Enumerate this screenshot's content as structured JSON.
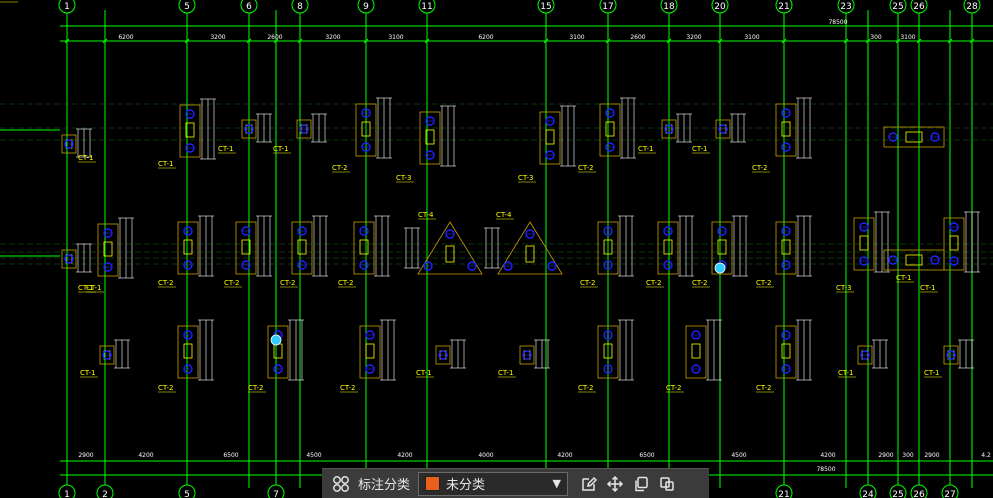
{
  "colors": {
    "background": "#000000",
    "grid": "#00ff00",
    "dimension": "#ffffff",
    "outline": "#c8a000",
    "pile": "#2020ff",
    "tag": "#ffff00",
    "axis_text": "#ffffff",
    "toolbar_bg": "#3b3b3b",
    "swatch": "#e8601c"
  },
  "axes_top": [
    "1",
    "5",
    "6",
    "8",
    "9",
    "11",
    "15",
    "17",
    "18",
    "20",
    "21",
    "23",
    "25",
    "26",
    "28"
  ],
  "axes_bottom": [
    "1",
    "2",
    "5",
    "7",
    "21",
    "24",
    "25",
    "26",
    "27"
  ],
  "dims_top": [
    "6200",
    "3200",
    "2600",
    "3200",
    "3100",
    "6200",
    "3100",
    "2600",
    "3200",
    "3100",
    "300",
    "3100"
  ],
  "total_top": "78500",
  "dims_bottom": [
    "2900",
    "4200",
    "6500",
    "4500",
    "4200",
    "4000",
    "4200",
    "6500",
    "4500",
    "4200",
    "2900",
    "300",
    "2900",
    "4.2"
  ],
  "total_bottom": "78500",
  "caps_row1": [
    "CT-1",
    "CT-1",
    "CT-1",
    "CT-1",
    "CT-2",
    "CT-3",
    "CT-3",
    "CT-2",
    "CT-1",
    "CT-1",
    "CT-2"
  ],
  "caps_row2": [
    "CT-1",
    "CT-1",
    "CT-2",
    "CT-2",
    "CT-2",
    "CT-2",
    "CT-4",
    "CT-4",
    "CT-2",
    "CT-2",
    "CT-2",
    "CT-2",
    "CT-3",
    "CT-1",
    "CT-1"
  ],
  "caps_row3": [
    "CT-1",
    "CT-2",
    "CT-2",
    "CT-2",
    "CT-1",
    "CT-1",
    "CT-2",
    "CT-2",
    "CT-2",
    "CT-1",
    "CT-1"
  ],
  "toolbar": {
    "grid_icon": "grid-icon",
    "label": "标注分类",
    "selected": "未分类",
    "caret": "▼",
    "edit_icon": "edit-icon",
    "move_icon": "move-icon",
    "copy_icon": "copy-icon",
    "paste_icon": "paste-icon"
  }
}
